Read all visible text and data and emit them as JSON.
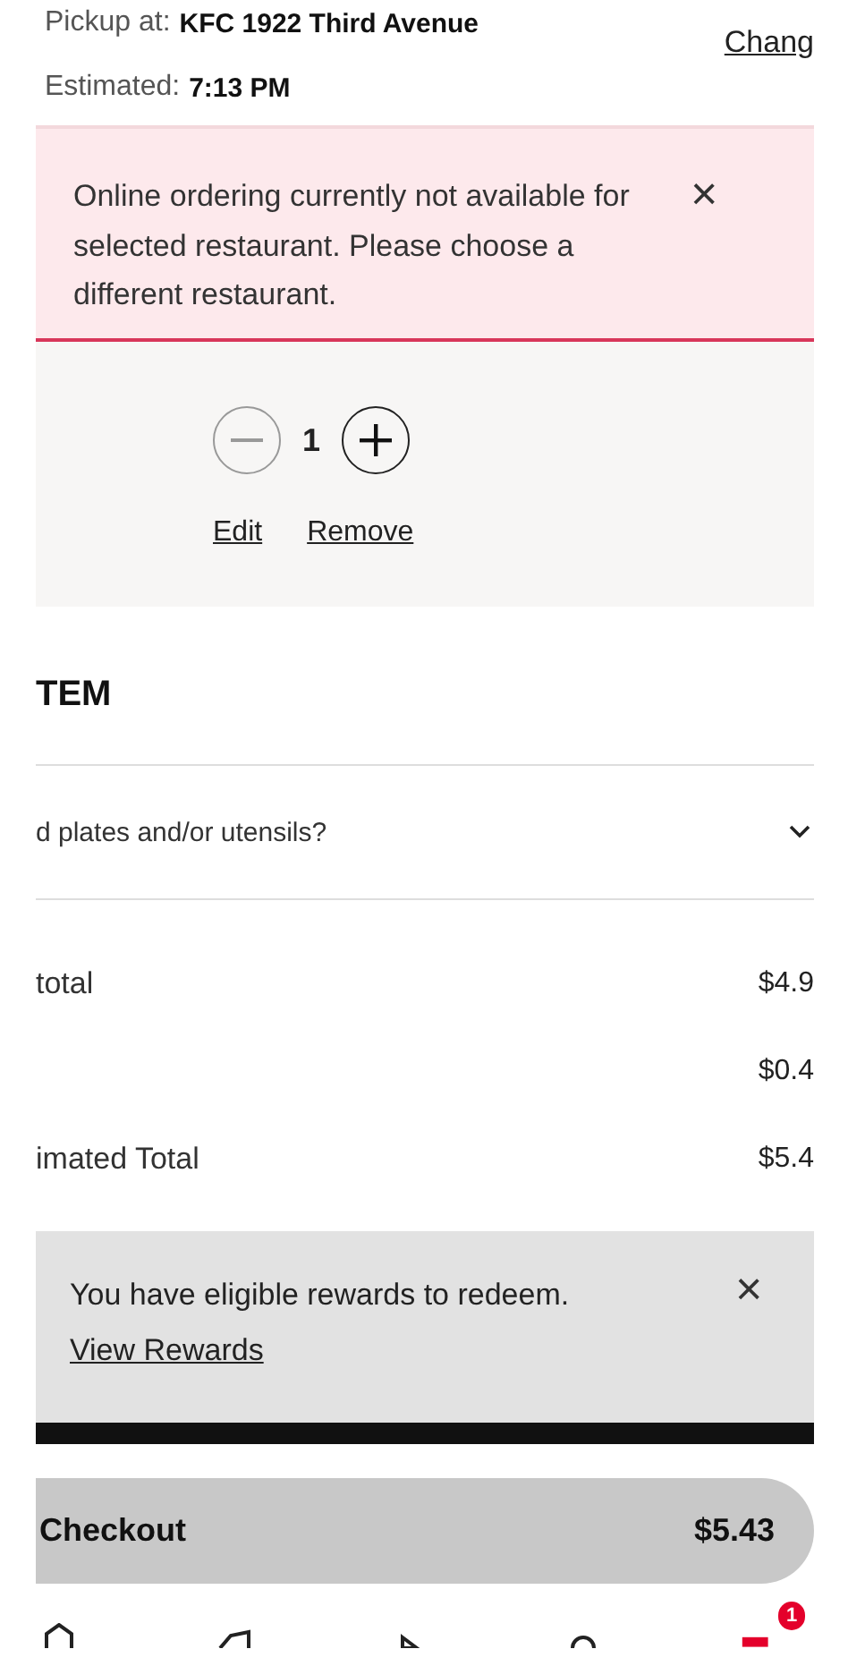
{
  "pickup": {
    "label": "Pickup at:",
    "restaurant": "KFC 1922 Third Avenue",
    "change_link": "Chang",
    "estimated_label": "Estimated:",
    "estimated_time": "7:13 PM"
  },
  "error_banner": {
    "message": "Online ordering currently not available for selected restaurant.  Please choose a different restaurant.",
    "close": "×"
  },
  "cart_item": {
    "quantity": "1",
    "actions": [
      "Edit",
      "Remove"
    ]
  },
  "section_heading": "TEM",
  "utensils_row": {
    "label": "d plates and/or utensils?",
    "expanded": false
  },
  "totals": [
    {
      "label": "total",
      "value": "$4.9"
    },
    {
      "value": "$0.4"
    },
    {
      "label": "imated Total",
      "value": "$5.4"
    }
  ],
  "rewards_banner": {
    "message": "You have eligible rewards to redeem.",
    "link": "View Rewards",
    "close": "×"
  },
  "checkout": {
    "label": "Checkout",
    "total": "$5.43"
  },
  "bottom_nav": {
    "badge": "1"
  }
}
